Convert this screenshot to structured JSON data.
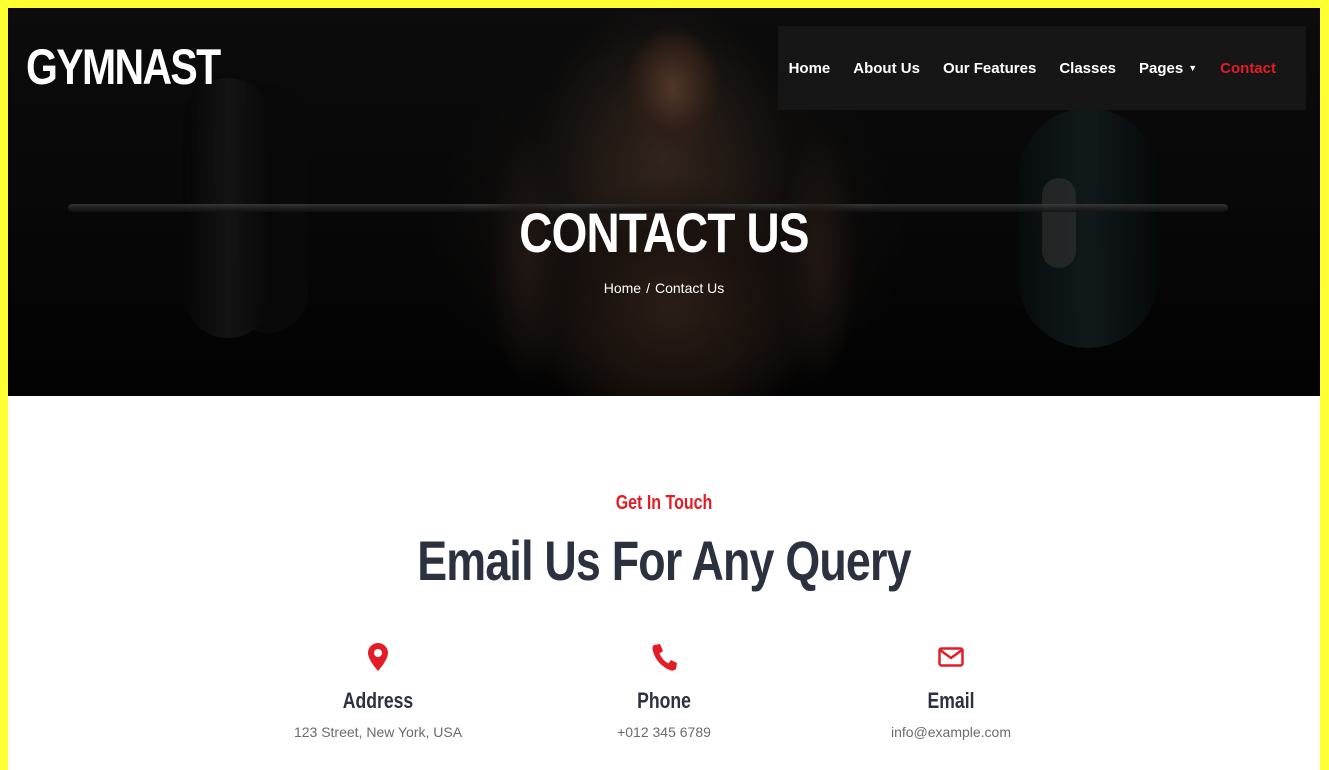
{
  "brand": {
    "logo": "GYMNAST"
  },
  "nav": {
    "items": [
      {
        "label": "Home",
        "active": false
      },
      {
        "label": "About Us",
        "active": false
      },
      {
        "label": "Our Features",
        "active": false
      },
      {
        "label": "Classes",
        "active": false
      },
      {
        "label": "Pages",
        "active": false,
        "dropdown": true
      },
      {
        "label": "Contact",
        "active": true
      }
    ]
  },
  "hero": {
    "title": "CONTACT US",
    "breadcrumb": {
      "home": "Home",
      "separator": "/",
      "current": "Contact Us"
    }
  },
  "section": {
    "eyebrow": "Get In Touch",
    "title": "Email Us For Any Query"
  },
  "contacts": [
    {
      "icon": "map-marker-icon",
      "label": "Address",
      "value": "123 Street, New York, USA"
    },
    {
      "icon": "phone-icon",
      "label": "Phone",
      "value": "+012 345 6789"
    },
    {
      "icon": "envelope-icon",
      "label": "Email",
      "value": "info@example.com"
    }
  ],
  "colors": {
    "accent": "#e31c25",
    "heading": "#2c3140",
    "nav_bg": "#161616",
    "page_border": "#ffff33"
  }
}
